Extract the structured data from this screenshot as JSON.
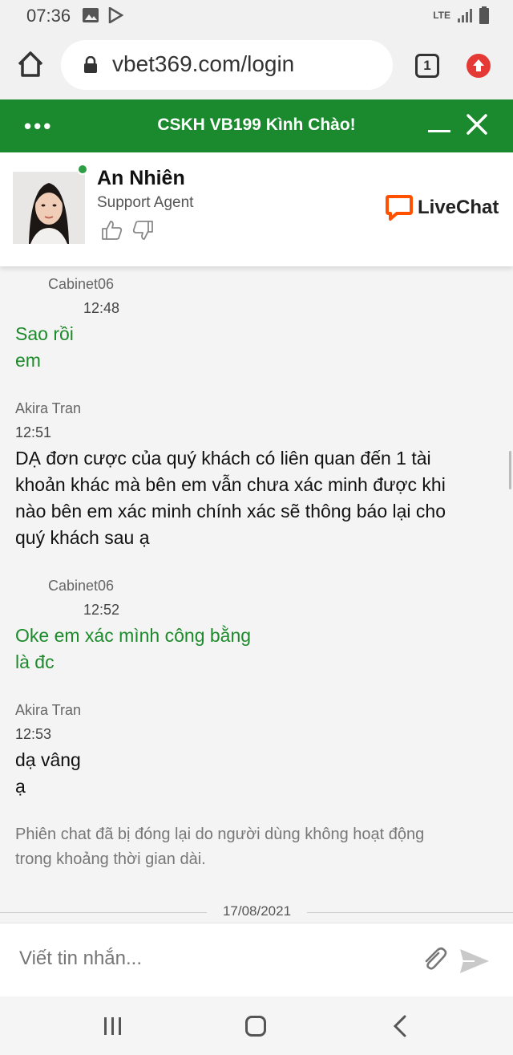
{
  "status_bar": {
    "time": "07:36",
    "network": "LTE"
  },
  "browser": {
    "url": "vbet369.com/login",
    "tab_count": "1"
  },
  "chat_header": {
    "title": "CSKH VB199 Kình Chào!",
    "menu_icon": "dots-icon"
  },
  "agent": {
    "name": "An Nhiên",
    "role": "Support Agent",
    "brand": "LiveChat"
  },
  "messages": [
    {
      "author": "Cabinet06",
      "time": "12:48",
      "lines": [
        "Sao rồi",
        "em"
      ]
    },
    {
      "author": "Akira Tran",
      "time": "12:51",
      "lines": [
        "DẠ đơn cược của quý khách có liên quan đến 1 tài",
        "khoản khác mà bên em vẫn chưa xác minh được khi",
        "nào bên em xác minh chính xác sẽ thông báo lại cho",
        "quý khách sau ạ"
      ]
    },
    {
      "author": "Cabinet06",
      "time": "12:52",
      "lines": [
        "Oke em xác mình công bằng",
        "là đc"
      ]
    },
    {
      "author": "Akira Tran",
      "time": "12:53",
      "lines": [
        "dạ vâng",
        "ạ"
      ]
    }
  ],
  "system_message": {
    "line1": "Phiên chat đã bị đóng lại do người dùng không hoạt động",
    "line2": "trong khoảng thời gian dài."
  },
  "date_separator": "17/08/2021",
  "composer": {
    "placeholder": "Viết tin nhắn..."
  },
  "colors": {
    "header_green": "#1b8a2e",
    "visitor_text": "#1d8a2b",
    "livechat_orange": "#ff5100"
  }
}
